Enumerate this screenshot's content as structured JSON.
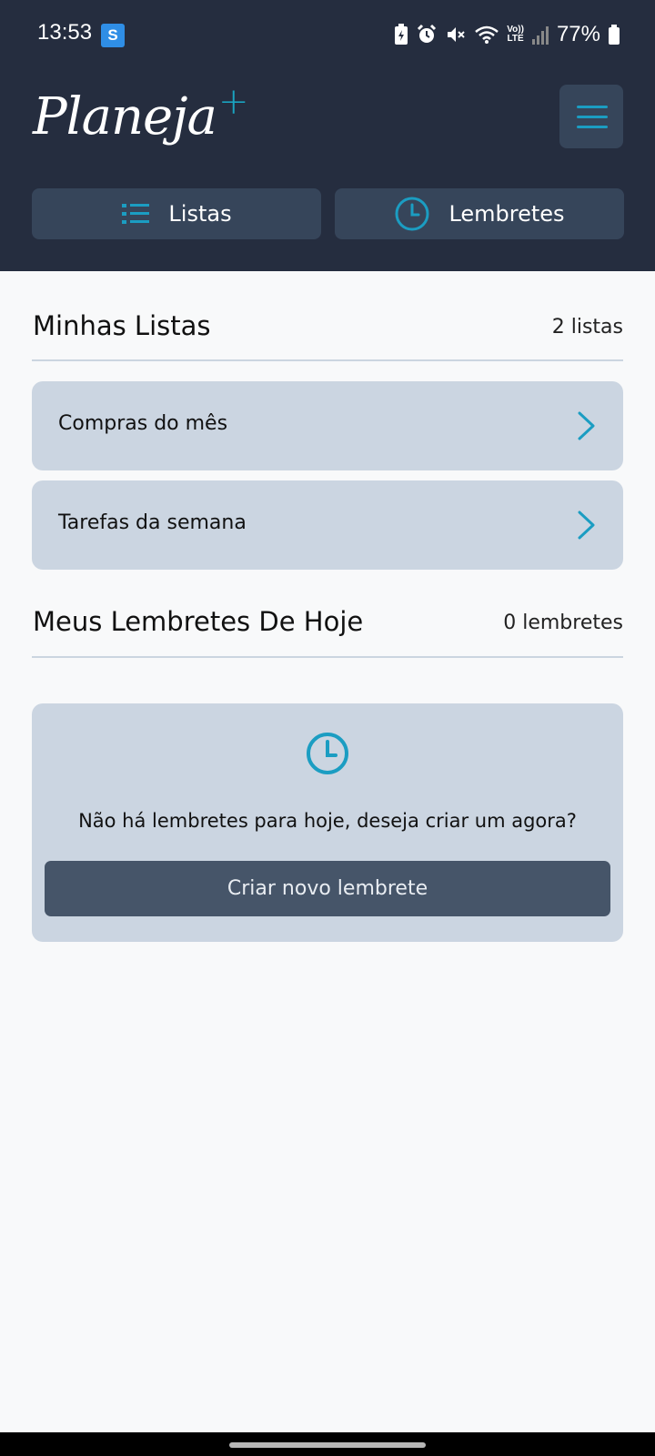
{
  "status_bar": {
    "time": "13:53",
    "app_badge": "S",
    "volte_top": "Vo))",
    "volte_bottom": "LTE",
    "battery": "77%"
  },
  "header": {
    "logo_text": "Planeja",
    "logo_plus": "+",
    "tabs": [
      {
        "label": "Listas",
        "icon": "list-icon"
      },
      {
        "label": "Lembretes",
        "icon": "clock-icon"
      }
    ]
  },
  "lists_section": {
    "title": "Minhas Listas",
    "count": "2 listas",
    "items": [
      {
        "label": "Compras do mês"
      },
      {
        "label": "Tarefas da semana"
      }
    ]
  },
  "reminders_section": {
    "title": "Meus Lembretes De Hoje",
    "count": "0 lembretes",
    "empty_message": "Não há lembretes para hoje, deseja criar um agora?",
    "create_button": "Criar novo lembrete"
  },
  "colors": {
    "header_bg": "#252d3f",
    "accent": "#1b9dc2",
    "card_bg": "#cbd5e1",
    "button_bg": "#465569"
  }
}
